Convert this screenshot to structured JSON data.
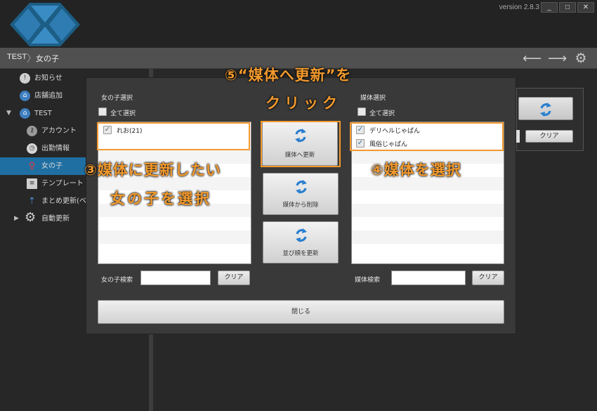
{
  "app": {
    "version": "version 2.8.3",
    "window_buttons": [
      "_",
      "□",
      "✕"
    ]
  },
  "navbar": {
    "root": "TEST",
    "current": "女の子",
    "icons": [
      "arrow-left-icon",
      "arrow-right-icon",
      "gear-icon"
    ]
  },
  "sidebar": {
    "items": [
      {
        "label": "お知らせ",
        "icon": "info-icon"
      },
      {
        "label": "店舗追加",
        "icon": "home-plus-icon"
      },
      {
        "label": "TEST",
        "icon": "home-icon"
      },
      {
        "label": "アカウント",
        "icon": "key-icon"
      },
      {
        "label": "出勤情報",
        "icon": "clock-icon"
      },
      {
        "label": "女の子",
        "icon": "girl-icon"
      },
      {
        "label": "テンプレート",
        "icon": "document-icon"
      },
      {
        "label": "まとめ更新(ベー",
        "icon": "upload-icon"
      },
      {
        "label": "自動更新",
        "icon": "gear-icon"
      }
    ]
  },
  "right_panel": {
    "clear_label": "クリア"
  },
  "dialog": {
    "girls": {
      "title": "女の子選択",
      "select_all": "全て選択",
      "items": [
        {
          "label": "れお(21)",
          "checked": true
        }
      ],
      "search_label": "女の子検索",
      "search_value": "",
      "clear_label": "クリア"
    },
    "media": {
      "title": "媒体選択",
      "select_all": "全て選択",
      "items": [
        {
          "label": "デリヘルじゃぱん",
          "checked": true
        },
        {
          "label": "風俗じゃぱん",
          "checked": true
        }
      ],
      "search_label": "媒体検索",
      "search_value": "",
      "clear_label": "クリア"
    },
    "actions": {
      "update": "媒体へ更新",
      "delete": "媒体から削除",
      "reorder": "並び順を更新"
    },
    "close_label": "閉じる"
  },
  "annotations": {
    "step5_line1": "⑤“媒体へ更新”を",
    "step5_line2": "クリック",
    "step3_line1": "③媒体に更新したい",
    "step3_line2": "女の子を選択",
    "step4": "④媒体を選択"
  },
  "colors": {
    "accent": "#1f6fa3",
    "highlight": "#f29a2e",
    "icon_blue": "#2a7fcf"
  }
}
